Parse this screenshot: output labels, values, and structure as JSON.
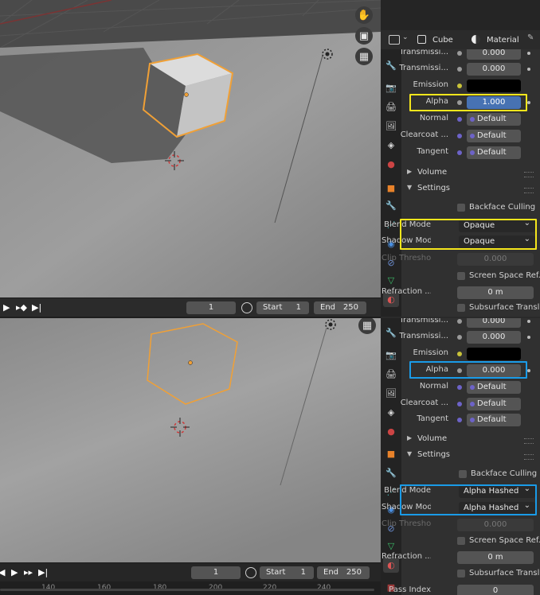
{
  "colors": {
    "accent_blue": "#4772b3",
    "yellow_highlight": "#f5e61c",
    "blue_highlight": "#1a9be8",
    "selection_orange": "#f0a036"
  },
  "top": {
    "header": {
      "object_label": "Cube",
      "material_label": "Material"
    },
    "rows": [
      {
        "label": "Transmissi...",
        "value": "0.000"
      },
      {
        "label": "Transmissi...",
        "value": "0.000"
      },
      {
        "label": "Emission",
        "value": ""
      },
      {
        "label": "Alpha",
        "value": "1.000"
      },
      {
        "label": "Normal",
        "value": "Default"
      },
      {
        "label": "Clearcoat ...",
        "value": "Default"
      },
      {
        "label": "Tangent",
        "value": "Default"
      }
    ],
    "sections": {
      "volume": "Volume",
      "settings": "Settings"
    },
    "backface_culling": "Backface Culling",
    "blend_mode": {
      "label": "Blend Mode",
      "value": "Opaque"
    },
    "shadow_mode": {
      "label": "Shadow Mod",
      "value": "Opaque"
    },
    "clip_threshold": {
      "label": "Clip Thresho...",
      "value": "0.000"
    },
    "screen_space_ref": "Screen Space Ref...",
    "refraction": {
      "label": "Refraction ...",
      "value": "0 m"
    },
    "subsurface": "Subsurface Transl...",
    "timeline": {
      "current": "1",
      "start_label": "Start",
      "start": "1",
      "end_label": "End",
      "end": "250"
    }
  },
  "bottom": {
    "rows": [
      {
        "label": "Transmissi...",
        "value": "0.000"
      },
      {
        "label": "Transmissi...",
        "value": "0.000"
      },
      {
        "label": "Emission",
        "value": ""
      },
      {
        "label": "Alpha",
        "value": "0.000"
      },
      {
        "label": "Normal",
        "value": "Default"
      },
      {
        "label": "Clearcoat ...",
        "value": "Default"
      },
      {
        "label": "Tangent",
        "value": "Default"
      }
    ],
    "sections": {
      "volume": "Volume",
      "settings": "Settings"
    },
    "backface_culling": "Backface Culling",
    "blend_mode": {
      "label": "Blend Mode",
      "value": "Alpha Hashed"
    },
    "shadow_mode": {
      "label": "Shadow Mod",
      "value": "Alpha Hashed"
    },
    "clip_threshold": {
      "label": "Clip Thresho...",
      "value": "0.000"
    },
    "screen_space_ref": "Screen Space Ref...",
    "refraction": {
      "label": "Refraction ...",
      "value": "0 m"
    },
    "subsurface": "Subsurface Transl...",
    "pass_index": {
      "label": "Pass Index",
      "value": "0"
    },
    "timeline": {
      "current": "1",
      "start_label": "Start",
      "start": "1",
      "end_label": "End",
      "end": "250"
    },
    "ruler": [
      "140",
      "160",
      "180",
      "200",
      "220",
      "240"
    ]
  },
  "icons": [
    "hand-icon",
    "camera-icon",
    "grid-icon",
    "render-properties-icon",
    "output-properties-icon",
    "view-layer-icon",
    "scene-icon",
    "world-icon",
    "object-properties-icon",
    "modifier-icon",
    "particles-icon",
    "physics-icon",
    "constraints-icon",
    "object-data-icon",
    "material-icon",
    "texture-icon"
  ]
}
